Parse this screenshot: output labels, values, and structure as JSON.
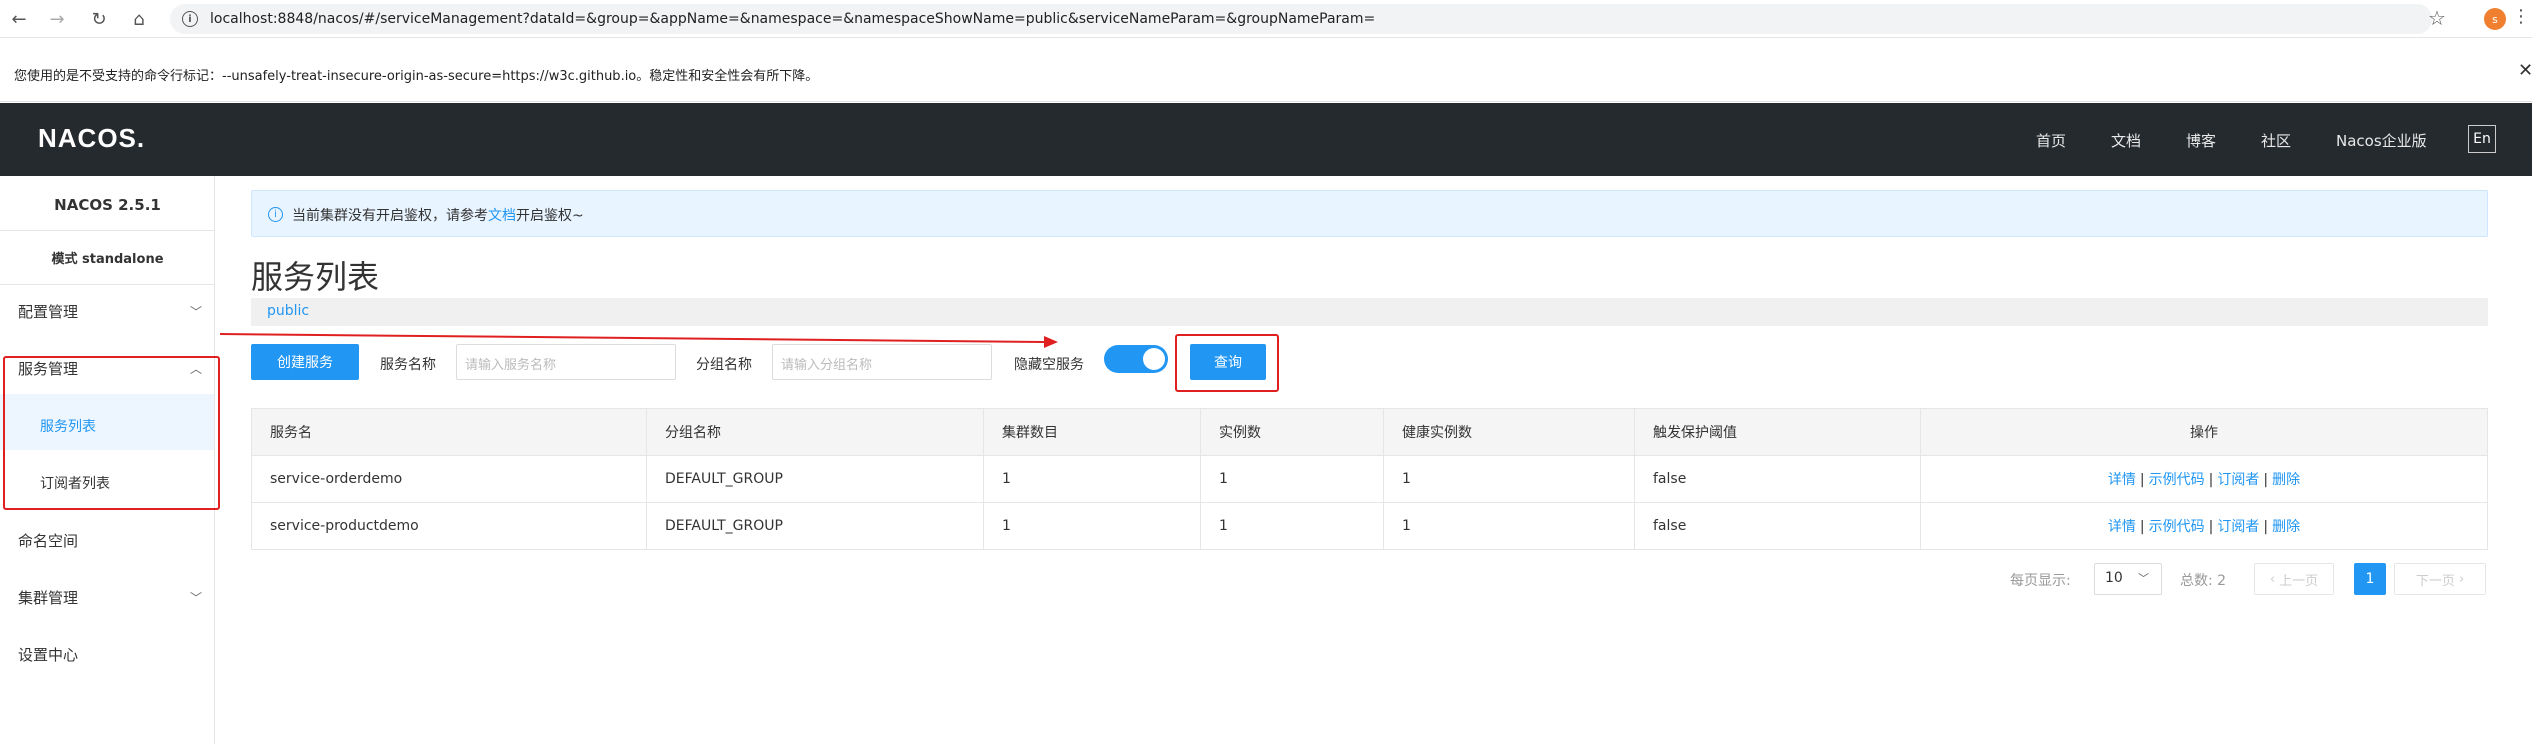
{
  "browser": {
    "url": "localhost:8848/nacos/#/serviceManagement?dataId=&group=&appName=&namespace=&namespaceShowName=public&serviceNameParam=&groupNameParam=",
    "profile_initial": "s",
    "icons": [
      "back-icon",
      "forward-icon",
      "reload-icon",
      "home-icon",
      "info-icon",
      "star-icon",
      "menu-icon"
    ]
  },
  "warning": {
    "text": "您使用的是不受支持的命令行标记：--unsafely-treat-insecure-origin-as-secure=https://w3c.github.io。稳定性和安全性会有所下降。",
    "close": "✕"
  },
  "header": {
    "logo": "NACOS.",
    "nav": [
      "首页",
      "文档",
      "博客",
      "社区",
      "Nacos企业版"
    ],
    "lang": "En"
  },
  "sidebar": {
    "version": "NACOS 2.5.1",
    "mode": "模式 standalone",
    "items": {
      "config": "配置管理",
      "service": "服务管理",
      "service_list": "服务列表",
      "subscriber_list": "订阅者列表",
      "namespace": "命名空间",
      "cluster": "集群管理",
      "settings": "设置中心"
    }
  },
  "alert": {
    "prefix": "当前集群没有开启鉴权，请参考",
    "link": "文档",
    "suffix": "开启鉴权~"
  },
  "main": {
    "title": "服务列表",
    "namespace": "public",
    "create_button": "创建服务",
    "service_name_label": "服务名称",
    "service_name_placeholder": "请输入服务名称",
    "group_name_label": "分组名称",
    "group_name_placeholder": "请输入分组名称",
    "hide_empty_label": "隐藏空服务",
    "hide_empty_on": true,
    "query_button": "查询"
  },
  "table": {
    "headers": [
      "服务名",
      "分组名称",
      "集群数目",
      "实例数",
      "健康实例数",
      "触发保护阈值",
      "操作"
    ],
    "rows": [
      [
        "service-orderdemo",
        "DEFAULT_GROUP",
        "1",
        "1",
        "1",
        "false"
      ],
      [
        "service-productdemo",
        "DEFAULT_GROUP",
        "1",
        "1",
        "1",
        "false"
      ]
    ],
    "ops": [
      "详情",
      "示例代码",
      "订阅者",
      "删除"
    ]
  },
  "pagination": {
    "per_page_label": "每页显示:",
    "per_page_value": "10",
    "total_label": "总数: 2",
    "prev": "上一页",
    "current": "1",
    "next": "下一页"
  },
  "colors": {
    "accent": "#2196f3",
    "header_bg": "#252a2f",
    "annotation_red": "#e02020"
  }
}
